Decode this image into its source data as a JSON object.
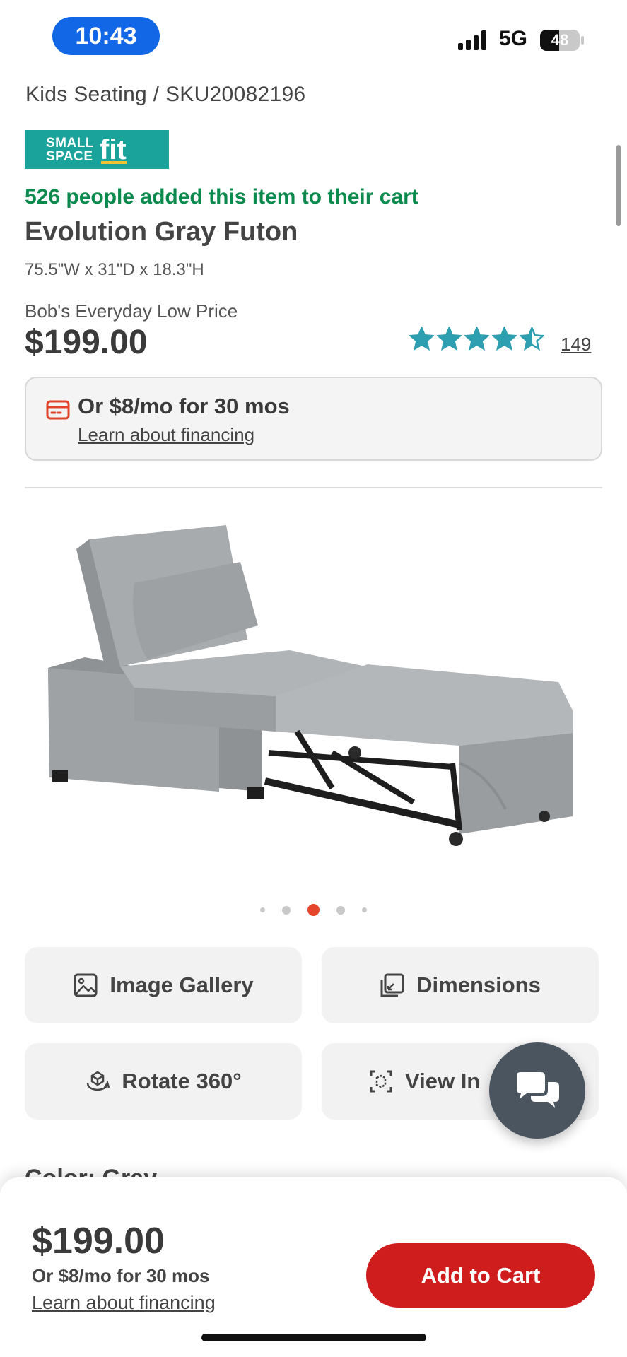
{
  "status_bar": {
    "time": "10:43",
    "network": "5G",
    "battery": "48",
    "battery_level": 0.48
  },
  "breadcrumb": "Kids Seating /  SKU20082196",
  "badge": {
    "line1": "SMALL",
    "line2": "SPACE",
    "word": "fit"
  },
  "social_proof": "526 people added this item to their cart",
  "product": {
    "title": "Evolution Gray Futon",
    "dimensions": "75.5\"W x 31\"D x 18.3\"H",
    "price_label": "Bob's Everyday Low Price",
    "price": "$199.00",
    "rating": 4.5,
    "rating_max": 5,
    "review_count": "149"
  },
  "financing": {
    "monthly": "Or $8/mo for 30 mos",
    "link": "Learn about financing"
  },
  "carousel": {
    "total": 5,
    "active_index": 2
  },
  "actions": {
    "gallery": "Image Gallery",
    "dimensions": "Dimensions",
    "rotate": "Rotate 360°",
    "view_in": "View In"
  },
  "peek_text": "Color: Gray",
  "sticky": {
    "price": "$199.00",
    "monthly": "Or $8/mo for 30 mos",
    "link": "Learn about financing",
    "cta": "Add to Cart"
  },
  "colors": {
    "accent": "#cf1c1c",
    "status_pill": "#1167e6",
    "proof_green": "#0b8a4d",
    "star": "#2e9fb0",
    "badge_teal": "#1aa39b"
  }
}
